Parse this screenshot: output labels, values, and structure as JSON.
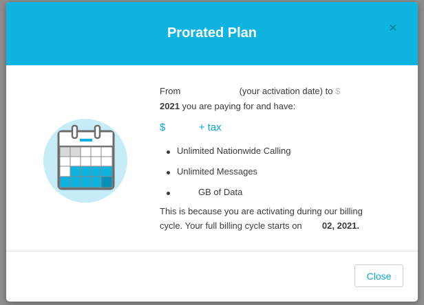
{
  "modal": {
    "title": "Prorated Plan",
    "close_icon": "close-icon",
    "intro": {
      "from": "From",
      "activation": "(your activation date) to",
      "cut": "$",
      "year": "2021",
      "rest": "you are paying for and have:"
    },
    "price": {
      "currency": "$",
      "suffix": "+ tax"
    },
    "features": [
      "Unlimited Nationwide Calling",
      "Unlimited Messages",
      "GB of Data"
    ],
    "explain": {
      "line1": "This is because you are activating during our billing",
      "line2_prefix": "cycle. Your full billing cycle starts on",
      "line2_date": "02, 2021."
    },
    "close_button": "Close",
    "illustration": "calendar-icon",
    "colors": {
      "header": "#0fb3e0",
      "accent": "#0aa6d2"
    }
  }
}
